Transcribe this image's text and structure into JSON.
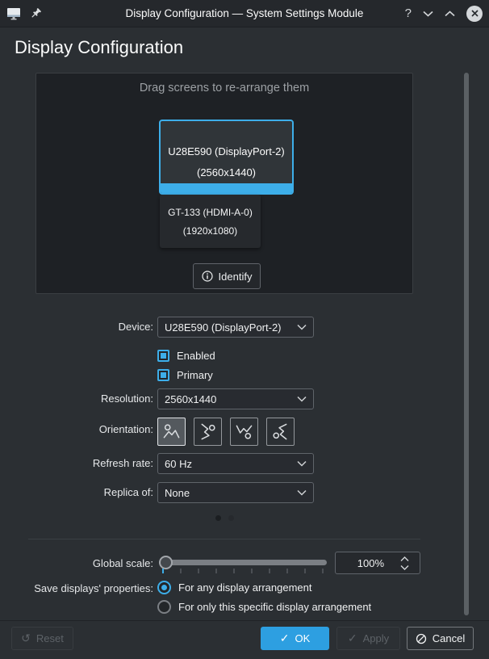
{
  "window": {
    "title": "Display Configuration — System Settings Module",
    "help_glyph": "?",
    "icons": [
      "monitor-icon",
      "pin-icon",
      "help-icon",
      "shade-icon",
      "maximize-icon",
      "close-icon"
    ]
  },
  "page": {
    "title": "Display Configuration"
  },
  "screen_area": {
    "hint": "Drag screens to re-arrange them",
    "screens": [
      {
        "name": "U28E590 (DisplayPort-2)",
        "resolution": "(2560x1440)",
        "selected": true
      },
      {
        "name": "GT-133 (HDMI-A-0)",
        "resolution": "(1920x1080)",
        "selected": false
      }
    ],
    "identify_label": "Identify"
  },
  "form": {
    "device": {
      "label": "Device:",
      "value": "U28E590 (DisplayPort-2)"
    },
    "enabled": {
      "label": "Enabled",
      "checked": true
    },
    "primary": {
      "label": "Primary",
      "checked": true
    },
    "resolution": {
      "label": "Resolution:",
      "value": "2560x1440"
    },
    "orientation": {
      "label": "Orientation:",
      "options": [
        "landscape",
        "portrait",
        "landscape-flipped",
        "portrait-flipped"
      ],
      "selected_index": 0
    },
    "refresh_rate": {
      "label": "Refresh rate:",
      "value": "60 Hz"
    },
    "replica_of": {
      "label": "Replica of:",
      "value": "None"
    }
  },
  "page_indicator": {
    "count": 2,
    "active": 1
  },
  "global_scale": {
    "label": "Global scale:",
    "value": "100%",
    "slider_position": 0
  },
  "save_properties": {
    "label": "Save displays' properties:",
    "options": [
      {
        "label": "For any display arrangement",
        "selected": true
      },
      {
        "label": "For only this specific display arrangement",
        "selected": false
      }
    ]
  },
  "buttons": {
    "reset": {
      "label": "Reset",
      "icon": "undo-icon",
      "glyph": "↺",
      "enabled": false
    },
    "ok": {
      "label": "OK",
      "icon": "check-icon",
      "glyph": "✓",
      "enabled": true
    },
    "apply": {
      "label": "Apply",
      "icon": "check-icon",
      "glyph": "✓",
      "enabled": false
    },
    "cancel": {
      "label": "Cancel",
      "icon": "prohibit-icon",
      "enabled": true
    }
  },
  "colors": {
    "accent": "#3daee9",
    "window_bg": "#2b2f33",
    "canvas_bg": "#1e2125",
    "ok_button": "#2d9fe1"
  }
}
